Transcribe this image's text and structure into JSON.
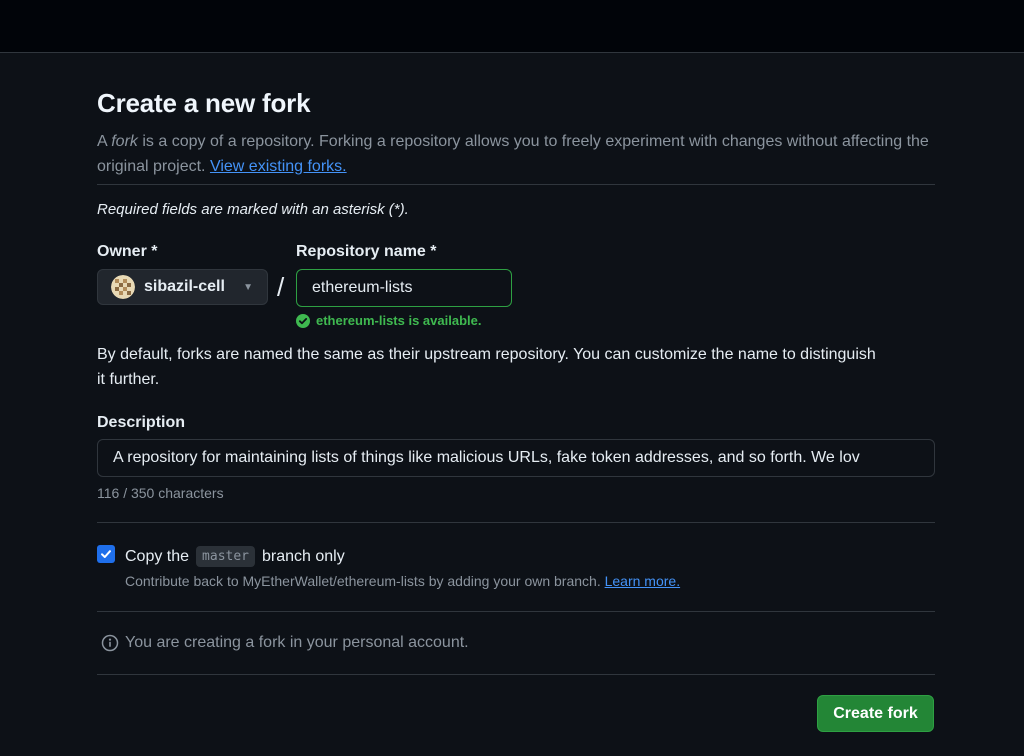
{
  "page": {
    "title": "Create a new fork",
    "intro_prefix": "A ",
    "intro_em": "fork",
    "intro_mid": " is a copy of a repository. Forking a repository allows you to freely experiment with changes without affecting the original project. ",
    "view_forks_link": "View existing forks.",
    "required_note": "Required fields are marked with an asterisk (*)."
  },
  "owner": {
    "label": "Owner *",
    "value": "sibazil-cell",
    "icon": "caret-down-icon"
  },
  "repo": {
    "separator": "/",
    "label": "Repository name *",
    "value": "ethereum-lists",
    "availability": "ethereum-lists is available.",
    "availability_color": "#3fb950"
  },
  "naming_help": "By default, forks are named the same as their upstream repository. You can customize the name to distinguish it further.",
  "description": {
    "label": "Description",
    "value": "A repository for maintaining lists of things like malicious URLs, fake token addresses, and so forth. We lov",
    "char_count": "116 / 350 characters"
  },
  "copy_branch": {
    "checked": true,
    "label_prefix": "Copy the",
    "branch": "master",
    "label_suffix": "branch only",
    "hint_prefix": "Contribute back to MyEtherWallet/ethereum-lists by adding your own branch. ",
    "learn_more": "Learn more."
  },
  "personal_note": "You are creating a fork in your personal account.",
  "create_button": "Create fork",
  "colors": {
    "background": "#0d1117",
    "link": "#4493f8",
    "primary_button": "#238636",
    "checkbox": "#1f6feb"
  }
}
